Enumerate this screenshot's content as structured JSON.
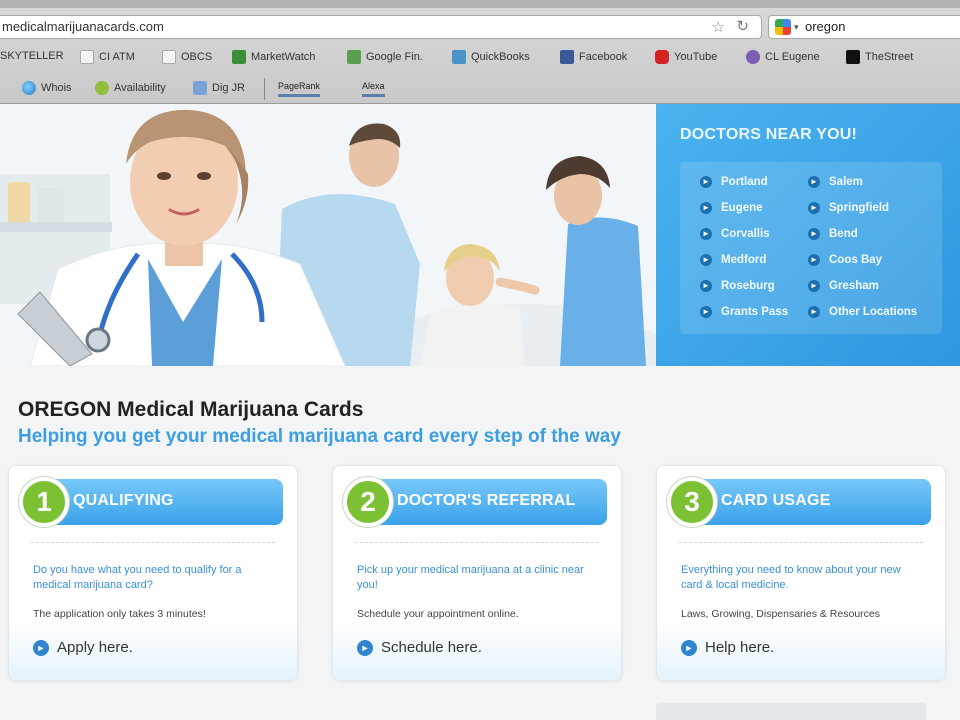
{
  "browser": {
    "url": "medicalmarijuanacards.com",
    "search_query": "oregon",
    "bookmarks_row1": [
      "SKYTELLER",
      "CI ATM",
      "OBCS",
      "MarketWatch",
      "Google Fin.",
      "QuickBooks",
      "Facebook",
      "YouTube",
      "CL Eugene",
      "TheStreet"
    ],
    "bookmarks_row2": [
      "Whois",
      "Availability",
      "Dig JR",
      "PageRank",
      "Alexa"
    ]
  },
  "doctors": {
    "title": "DOCTORS NEAR YOU!",
    "left_cities": [
      "Portland",
      "Eugene",
      "Corvallis",
      "Medford",
      "Roseburg",
      "Grants Pass"
    ],
    "right_cities": [
      "Salem",
      "Springfield",
      "Bend",
      "Coos Bay",
      "Gresham",
      "Other Locations"
    ]
  },
  "page": {
    "title": "OREGON Medical Marijuana Cards",
    "subtitle": "Helping you get your medical marijuana card every step of the way"
  },
  "steps": [
    {
      "number": "1",
      "title": "QUALIFYING",
      "question": "Do you have what you need to qualify for a medical marijuana card?",
      "note": "The application only takes 3 minutes!",
      "action": "Apply here."
    },
    {
      "number": "2",
      "title": "DOCTOR'S REFERRAL",
      "question": "Pick up your medical marijuana at a clinic near you!",
      "note": "Schedule your appointment online.",
      "action": "Schedule here."
    },
    {
      "number": "3",
      "title": "CARD USAGE",
      "question": "Everything you need to know about your new card & local medicine.",
      "note": "Laws, Growing, Dispensaries & Resources",
      "action": "Help here."
    }
  ],
  "colors": {
    "accent_blue": "#3d9ee0",
    "panel_blue": "#2e97df",
    "step_green": "#7cc133"
  },
  "icons": {
    "city_link": "arrow-right-icon",
    "action_link": "arrow-right-icon",
    "bookmark_star": "star-icon",
    "reload": "reload-icon"
  }
}
